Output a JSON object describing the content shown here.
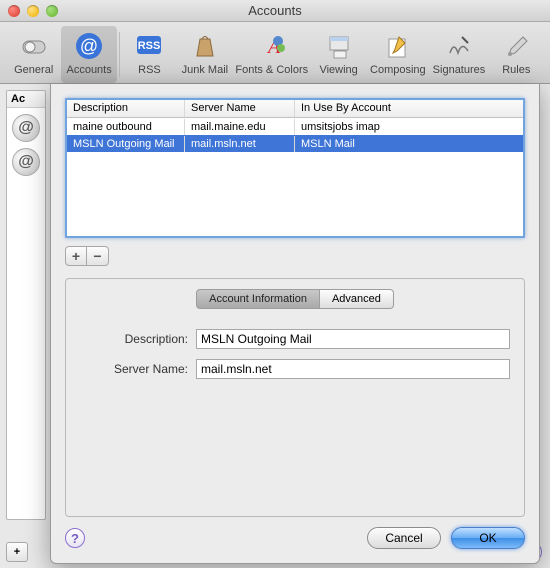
{
  "window": {
    "title": "Accounts"
  },
  "toolbar": {
    "items": [
      {
        "label": "General"
      },
      {
        "label": "Accounts"
      },
      {
        "label": "RSS"
      },
      {
        "label": "Junk Mail"
      },
      {
        "label": "Fonts & Colors"
      },
      {
        "label": "Viewing"
      },
      {
        "label": "Composing"
      },
      {
        "label": "Signatures"
      },
      {
        "label": "Rules"
      }
    ]
  },
  "bg_sidebar": {
    "header": "Ac"
  },
  "table": {
    "headers": {
      "description": "Description",
      "server_name": "Server Name",
      "in_use": "In Use By Account"
    },
    "rows": [
      {
        "description": "maine outbound",
        "server_name": "mail.maine.edu",
        "in_use": "umsitsjobs imap"
      },
      {
        "description": "MSLN Outgoing Mail",
        "server_name": "mail.msln.net",
        "in_use": "MSLN Mail"
      }
    ]
  },
  "tabs": {
    "account_info": "Account Information",
    "advanced": "Advanced"
  },
  "form": {
    "description_label": "Description:",
    "description_value": "MSLN Outgoing Mail",
    "server_label": "Server Name:",
    "server_value": "mail.msln.net"
  },
  "buttons": {
    "cancel": "Cancel",
    "ok": "OK"
  },
  "glyphs": {
    "plus": "+",
    "minus": "−",
    "help": "?"
  }
}
